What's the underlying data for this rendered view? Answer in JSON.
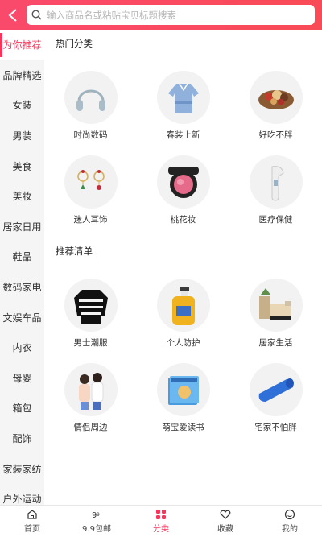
{
  "search": {
    "placeholder": "输入商品名或粘贴宝贝标题搜索"
  },
  "sidebar": {
    "items": [
      {
        "label": "为你推荐"
      },
      {
        "label": "品牌精选"
      },
      {
        "label": "女装"
      },
      {
        "label": "男装"
      },
      {
        "label": "美食"
      },
      {
        "label": "美妆"
      },
      {
        "label": "居家日用"
      },
      {
        "label": "鞋品"
      },
      {
        "label": "数码家电"
      },
      {
        "label": "文娱车品"
      },
      {
        "label": "内衣"
      },
      {
        "label": "母婴"
      },
      {
        "label": "箱包"
      },
      {
        "label": "配饰"
      },
      {
        "label": "家装家纺"
      },
      {
        "label": "户外运动"
      }
    ],
    "active_index": 0
  },
  "sections": [
    {
      "title": "热门分类",
      "items": [
        {
          "label": "时尚数码",
          "icon": "headphones-icon"
        },
        {
          "label": "春装上新",
          "icon": "blouse-icon"
        },
        {
          "label": "好吃不胖",
          "icon": "snack-bowl-icon"
        },
        {
          "label": "迷人耳饰",
          "icon": "earrings-icon"
        },
        {
          "label": "桃花妆",
          "icon": "blush-compact-icon"
        },
        {
          "label": "医疗保健",
          "icon": "thermometer-icon"
        }
      ]
    },
    {
      "title": "推荐清单",
      "items": [
        {
          "label": "男士潮服",
          "icon": "striped-sweater-icon"
        },
        {
          "label": "个人防护",
          "icon": "hand-sanitizer-icon"
        },
        {
          "label": "居家生活",
          "icon": "home-decor-icon"
        },
        {
          "label": "情侣周边",
          "icon": "couple-photo-icon"
        },
        {
          "label": "萌宝爱读书",
          "icon": "books-icon"
        },
        {
          "label": "宅家不怕胖",
          "icon": "yoga-mat-icon"
        }
      ]
    }
  ],
  "tabbar": {
    "items": [
      {
        "label": "首页",
        "icon": "home-icon"
      },
      {
        "label": "9.9包邮",
        "icon": "nine-nine-icon"
      },
      {
        "label": "分类",
        "icon": "category-icon"
      },
      {
        "label": "收藏",
        "icon": "heart-icon"
      },
      {
        "label": "我的",
        "icon": "profile-icon"
      }
    ],
    "active_index": 2
  },
  "colors": {
    "brand": "#f8345a",
    "header_start": "#fa4a6c",
    "header_end": "#f94a57"
  }
}
